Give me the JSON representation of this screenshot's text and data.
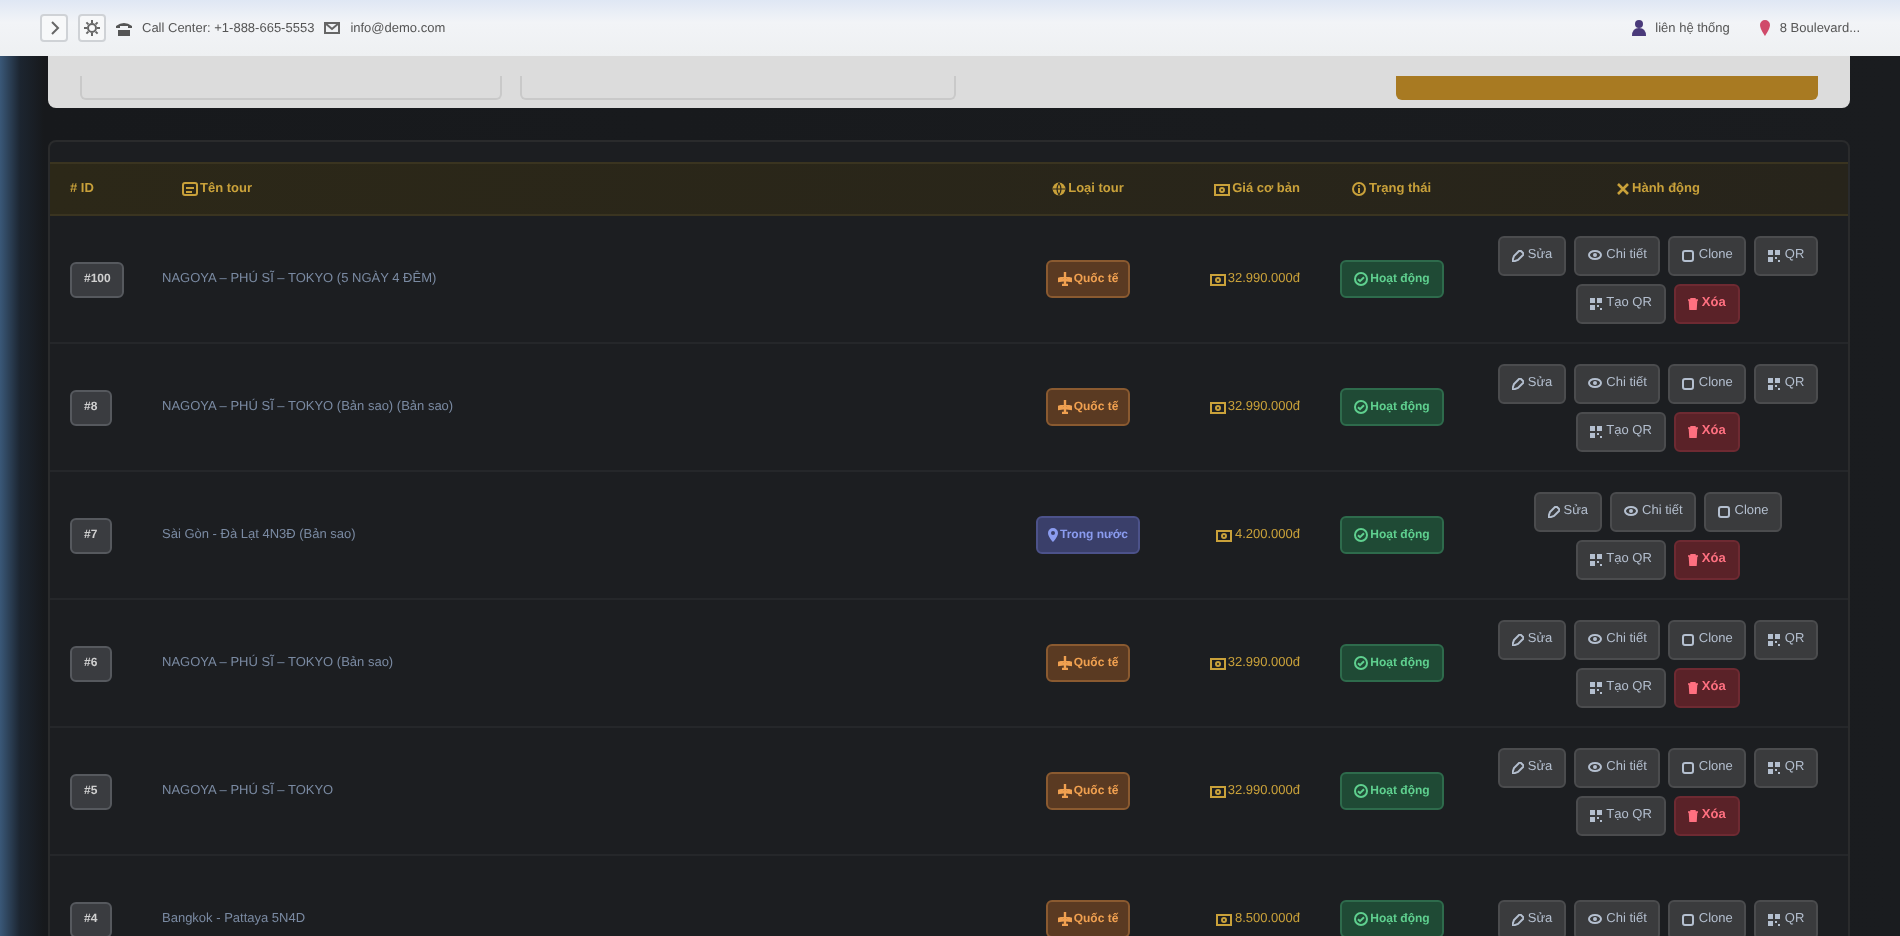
{
  "topbar": {
    "call_center": "Call Center: +1-888-665-5553",
    "email": "info@demo.com",
    "user_link": "liên hệ thống",
    "address": "8 Boulevard..."
  },
  "table": {
    "columns": [
      {
        "kind": "id",
        "label": "# ID"
      },
      {
        "kind": "name",
        "label": "Tên tour"
      },
      {
        "kind": "type",
        "label": "Loại tour"
      },
      {
        "kind": "price",
        "label": "Giá cơ bản"
      },
      {
        "kind": "status",
        "label": "Trạng thái"
      },
      {
        "kind": "actions",
        "label": "Hành động"
      }
    ],
    "rows": [
      {
        "id": "#100",
        "name": "NAGOYA – PHÚ SĨ – TOKYO (5 NGÀY 4 ĐÊM)",
        "type": {
          "kind": "international",
          "label": "Quốc tế"
        },
        "price": "32.990.000đ",
        "status": {
          "active": true,
          "label": "Hoạt động"
        },
        "actions": [
          {
            "kind": "edit",
            "label": "Sửa"
          },
          {
            "kind": "view",
            "label": "Chi tiết"
          },
          {
            "kind": "clone",
            "label": "Clone"
          },
          {
            "kind": "qr",
            "label": "QR"
          },
          {
            "kind": "qr",
            "label": "Tạo QR"
          },
          {
            "kind": "delete",
            "label": "Xóa"
          }
        ]
      },
      {
        "id": "#8",
        "name": "NAGOYA – PHÚ SĨ – TOKYO (Bản sao) (Bản sao)",
        "type": {
          "kind": "international",
          "label": "Quốc tế"
        },
        "price": "32.990.000đ",
        "status": {
          "active": true,
          "label": "Hoạt động"
        },
        "actions": [
          {
            "kind": "edit",
            "label": "Sửa"
          },
          {
            "kind": "view",
            "label": "Chi tiết"
          },
          {
            "kind": "clone",
            "label": "Clone"
          },
          {
            "kind": "qr",
            "label": "QR"
          },
          {
            "kind": "qr",
            "label": "Tạo QR"
          },
          {
            "kind": "delete",
            "label": "Xóa"
          }
        ]
      },
      {
        "id": "#7",
        "name": "Sài Gòn - Đà Lạt 4N3Đ (Bản sao)",
        "type": {
          "kind": "domestic",
          "label": "Trong nước"
        },
        "price": "4.200.000đ",
        "status": {
          "active": true,
          "label": "Hoạt động"
        },
        "actions": [
          {
            "kind": "edit",
            "label": "Sửa"
          },
          {
            "kind": "view",
            "label": "Chi tiết"
          },
          {
            "kind": "clone",
            "label": "Clone"
          },
          {
            "kind": "qr",
            "label": "Tạo QR"
          },
          {
            "kind": "delete",
            "label": "Xóa"
          }
        ]
      },
      {
        "id": "#6",
        "name": "NAGOYA – PHÚ SĨ – TOKYO (Bản sao)",
        "type": {
          "kind": "international",
          "label": "Quốc tế"
        },
        "price": "32.990.000đ",
        "status": {
          "active": true,
          "label": "Hoạt động"
        },
        "actions": [
          {
            "kind": "edit",
            "label": "Sửa"
          },
          {
            "kind": "view",
            "label": "Chi tiết"
          },
          {
            "kind": "clone",
            "label": "Clone"
          },
          {
            "kind": "qr",
            "label": "QR"
          },
          {
            "kind": "qr",
            "label": "Tạo QR"
          },
          {
            "kind": "delete",
            "label": "Xóa"
          }
        ]
      },
      {
        "id": "#5",
        "name": "NAGOYA – PHÚ SĨ – TOKYO",
        "type": {
          "kind": "international",
          "label": "Quốc tế"
        },
        "price": "32.990.000đ",
        "status": {
          "active": true,
          "label": "Hoạt động"
        },
        "actions": [
          {
            "kind": "edit",
            "label": "Sửa"
          },
          {
            "kind": "view",
            "label": "Chi tiết"
          },
          {
            "kind": "clone",
            "label": "Clone"
          },
          {
            "kind": "qr",
            "label": "QR"
          },
          {
            "kind": "qr",
            "label": "Tạo QR"
          },
          {
            "kind": "delete",
            "label": "Xóa"
          }
        ]
      },
      {
        "id": "#4",
        "name": "Bangkok - Pattaya 5N4D",
        "type": {
          "kind": "international",
          "label": "Quốc tế"
        },
        "price": "8.500.000đ",
        "status": {
          "active": true,
          "label": "Hoạt động"
        },
        "actions": [
          {
            "kind": "edit",
            "label": "Sửa"
          },
          {
            "kind": "view",
            "label": "Chi tiết"
          },
          {
            "kind": "clone",
            "label": "Clone"
          },
          {
            "kind": "qr",
            "label": "QR"
          }
        ]
      }
    ]
  }
}
